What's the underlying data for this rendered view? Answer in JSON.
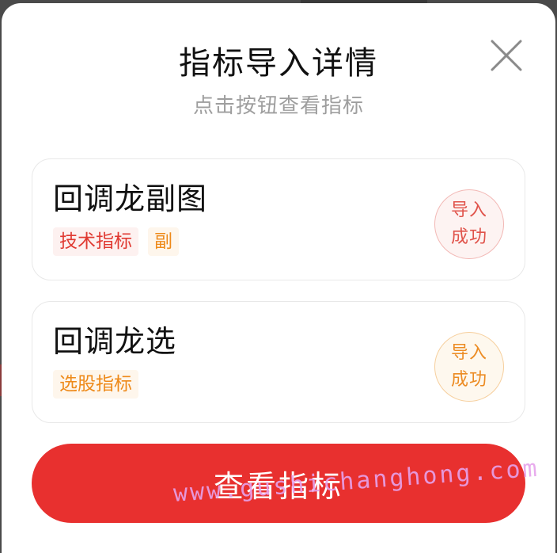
{
  "modal": {
    "title": "指标导入详情",
    "subtitle": "点击按钮查看指标",
    "close_icon": "close-icon"
  },
  "indicators": [
    {
      "name": "回调龙副图",
      "tags": [
        "技术指标",
        "副"
      ],
      "status_line1": "导入",
      "status_line2": "成功",
      "status_color": "#e0534b"
    },
    {
      "name": "回调龙选",
      "tags": [
        "选股指标"
      ],
      "status_line1": "导入",
      "status_line2": "成功",
      "status_color": "#ec8c24"
    }
  ],
  "actions": {
    "view_button_label": "查看指标"
  },
  "watermark": "www.gushichanghong.com",
  "colors": {
    "primary": "#e8302f",
    "tag_red": "#e03a32",
    "tag_orange": "#ee8a1a"
  }
}
